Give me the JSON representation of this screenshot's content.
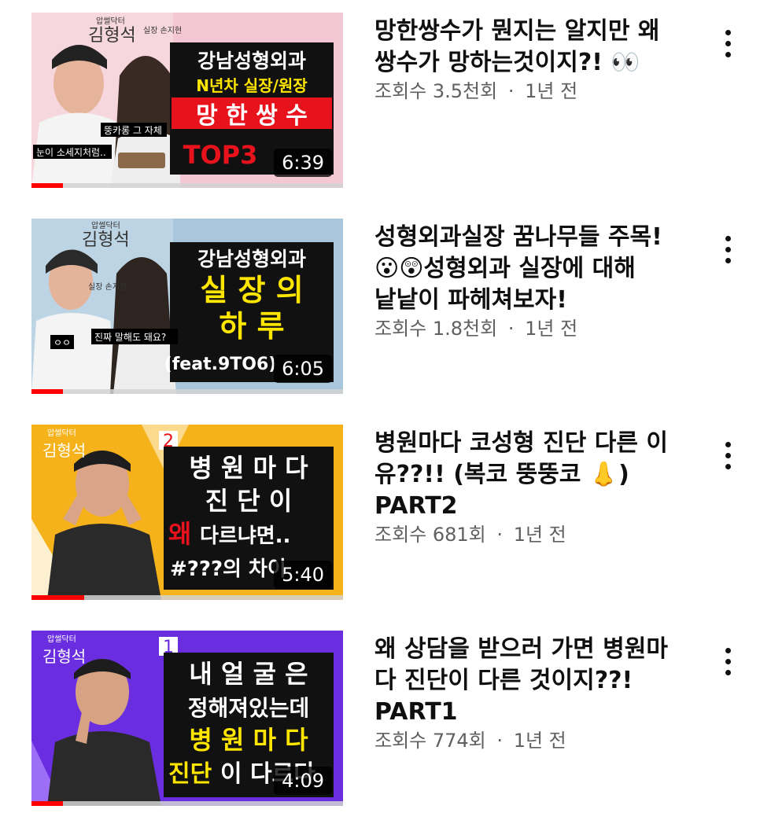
{
  "videos": [
    {
      "title": "망한쌍수가 뭔지는 알지만 왜\n쌍수가 망하는것이지?! 👀",
      "views": "조회수 3.5천회",
      "age": "1년 전",
      "duration": "6:39",
      "watched_fraction": 0.1,
      "thumb_text": {
        "handwriting": "김형석",
        "handwriting_small": "압썰닥터",
        "handwriting_side": "실장 손지현",
        "line1": "강남성형외과",
        "line2": "N년차 실장/원장",
        "line3": "망 한 쌍 수",
        "line4": "TOP3",
        "caption_left": "눈이 소세지처럼..",
        "caption_right": "뚱카롱 그 자체"
      }
    },
    {
      "title": "성형외과실장 꿈나무들 주목!\n😮😲성형외과 실장에 대해\n낱낱이 파헤쳐보자!",
      "views": "조회수 1.8천회",
      "age": "1년 전",
      "duration": "6:05",
      "watched_fraction": 0.1,
      "thumb_text": {
        "handwriting": "김형석",
        "handwriting_small": "압썰닥터",
        "handwriting_side": "실장 손지현",
        "line1": "강남성형외과",
        "line2": "실 장 의",
        "line3": "하   루",
        "line4": "(feat.9TO6)",
        "caption_left": "ㅇㅇ",
        "caption_right": "진짜 말해도 돼요?"
      }
    },
    {
      "title": "병원마다 코성형 진단 다른 이\n유??!! (복코 뚱뚱코 👃)\nPART2",
      "views": "조회수 681회",
      "age": "1년 전",
      "duration": "5:40",
      "watched_fraction": 0.17,
      "thumb_text": {
        "handwriting": "김형석",
        "handwriting_small": "압썰닥터",
        "number": "2",
        "line1": "병 원 마 다",
        "line2": "진   단   이",
        "line3_accent": "왜",
        "line3_rest": " 다르냐면..",
        "line4": "#???의 차이"
      }
    },
    {
      "title": "왜 상담을 받으러 가면 병원마\n다 진단이 다른 것이지??!\nPART1",
      "views": "조회수 774회",
      "age": "1년 전",
      "duration": "4:09",
      "watched_fraction": 0.1,
      "thumb_text": {
        "handwriting": "김형석",
        "handwriting_small": "압썰닥터",
        "number": "1",
        "line1": "내 얼 굴 은",
        "line2": "정해져있는데",
        "line3": "병 원 마 다",
        "line4_accent": "진단",
        "line4_rest": "이 다르다"
      }
    }
  ],
  "separator": "·",
  "colors": {
    "progress": "#ff0000",
    "accent_red": "#e8121c",
    "accent_yellow": "#ffe600",
    "thumb1_bg": "#f3c7d3",
    "thumb2_bg": "#a9c7dc",
    "thumb3_bg": "#f6b21a",
    "thumb4_bg": "#6a2ee0"
  },
  "icons": {
    "menu": "more-vertical-icon"
  }
}
